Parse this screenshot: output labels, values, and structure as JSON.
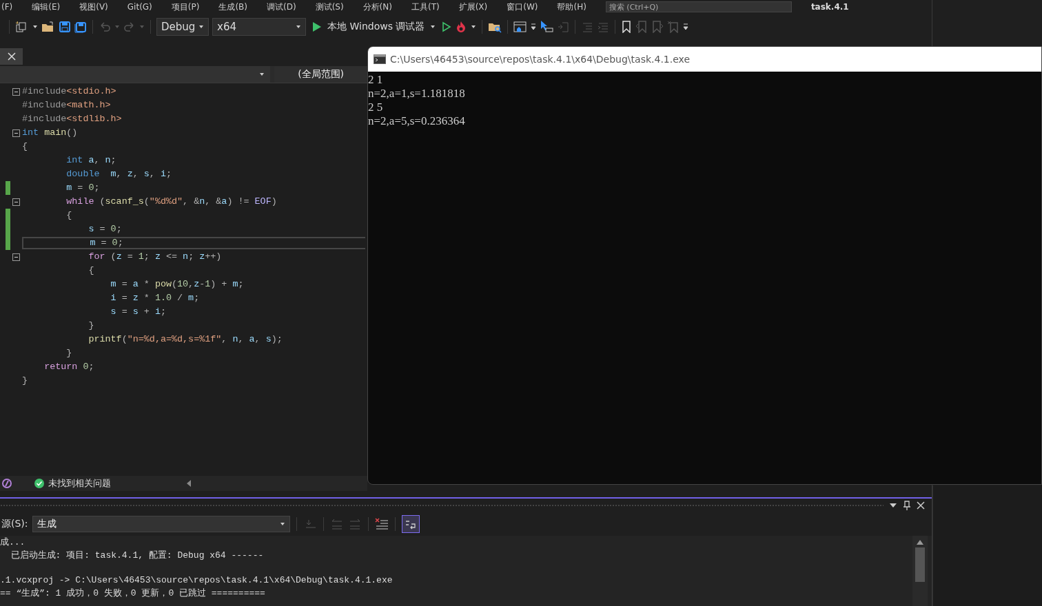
{
  "menu_bar": {
    "items": [
      "(F)",
      "编辑(E)",
      "视图(V)",
      "Git(G)",
      "项目(P)",
      "生成(B)",
      "调试(D)",
      "测试(S)",
      "分析(N)",
      "工具(T)",
      "扩展(X)",
      "窗口(W)",
      "帮助(H)"
    ],
    "search": {
      "placeholder": "搜索 (Ctrl+Q)"
    },
    "solution_title": "task.4.1"
  },
  "toolbar": {
    "configuration": "Debug",
    "platform": "x64",
    "run_button": "本地 Windows 调试器"
  },
  "editor": {
    "scope": "(全局范围)",
    "lines": [
      {
        "foldable": true,
        "changed": false,
        "current": false,
        "tokens": [
          {
            "kind": "dir",
            "text": "#include"
          },
          {
            "kind": "str",
            "text": "<stdio.h>"
          }
        ]
      },
      {
        "foldable": false,
        "changed": false,
        "current": false,
        "tokens": [
          {
            "kind": "dir",
            "text": "#include"
          },
          {
            "kind": "str",
            "text": "<math.h>"
          }
        ]
      },
      {
        "foldable": false,
        "changed": false,
        "current": false,
        "tokens": [
          {
            "kind": "dir",
            "text": "#include"
          },
          {
            "kind": "str",
            "text": "<stdlib.h>"
          }
        ]
      },
      {
        "foldable": true,
        "changed": false,
        "current": false,
        "tokens": [
          {
            "kind": "kw",
            "text": "int"
          },
          {
            "kind": "fn",
            "text": " main"
          },
          {
            "kind": "p",
            "text": "()"
          }
        ]
      },
      {
        "foldable": false,
        "changed": false,
        "current": false,
        "tokens": [
          {
            "kind": "p",
            "text": "{"
          }
        ]
      },
      {
        "foldable": false,
        "changed": false,
        "current": false,
        "tokens": [
          {
            "kind": "kw",
            "text": "        int"
          },
          {
            "kind": "var",
            "text": " a"
          },
          {
            "kind": "p",
            "text": ", "
          },
          {
            "kind": "var",
            "text": "n"
          },
          {
            "kind": "p",
            "text": ";"
          }
        ]
      },
      {
        "foldable": false,
        "changed": false,
        "current": false,
        "tokens": [
          {
            "kind": "kw",
            "text": "        double"
          },
          {
            "kind": "var",
            "text": "  m"
          },
          {
            "kind": "p",
            "text": ", "
          },
          {
            "kind": "var",
            "text": "z"
          },
          {
            "kind": "p",
            "text": ", "
          },
          {
            "kind": "var",
            "text": "s"
          },
          {
            "kind": "p",
            "text": ", "
          },
          {
            "kind": "var",
            "text": "i"
          },
          {
            "kind": "p",
            "text": ";"
          }
        ]
      },
      {
        "foldable": false,
        "changed": true,
        "current": false,
        "tokens": [
          {
            "kind": "var",
            "text": "        m"
          },
          {
            "kind": "p",
            "text": " = "
          },
          {
            "kind": "num",
            "text": "0"
          },
          {
            "kind": "p",
            "text": ";"
          }
        ]
      },
      {
        "foldable": true,
        "changed": false,
        "current": false,
        "tokens": [
          {
            "kind": "ctl",
            "text": "        while"
          },
          {
            "kind": "p",
            "text": " ("
          },
          {
            "kind": "fn",
            "text": "scanf_s"
          },
          {
            "kind": "p",
            "text": "("
          },
          {
            "kind": "str",
            "text": "\"%d%d\""
          },
          {
            "kind": "p",
            "text": ", &"
          },
          {
            "kind": "var",
            "text": "n"
          },
          {
            "kind": "p",
            "text": ", &"
          },
          {
            "kind": "var",
            "text": "a"
          },
          {
            "kind": "p",
            "text": ") != "
          },
          {
            "kind": "mac",
            "text": "EOF"
          },
          {
            "kind": "p",
            "text": ")"
          }
        ]
      },
      {
        "foldable": false,
        "changed": true,
        "current": false,
        "tokens": [
          {
            "kind": "p",
            "text": "        {"
          }
        ]
      },
      {
        "foldable": false,
        "changed": true,
        "current": false,
        "tokens": [
          {
            "kind": "var",
            "text": "            s"
          },
          {
            "kind": "p",
            "text": " = "
          },
          {
            "kind": "num",
            "text": "0"
          },
          {
            "kind": "p",
            "text": ";"
          }
        ]
      },
      {
        "foldable": false,
        "changed": true,
        "current": true,
        "tokens": [
          {
            "kind": "var",
            "text": "            m"
          },
          {
            "kind": "p",
            "text": " = "
          },
          {
            "kind": "num",
            "text": "0"
          },
          {
            "kind": "p",
            "text": ";"
          }
        ]
      },
      {
        "foldable": true,
        "changed": false,
        "current": false,
        "tokens": [
          {
            "kind": "ctl",
            "text": "            for"
          },
          {
            "kind": "p",
            "text": " ("
          },
          {
            "kind": "var",
            "text": "z"
          },
          {
            "kind": "p",
            "text": " = "
          },
          {
            "kind": "num",
            "text": "1"
          },
          {
            "kind": "p",
            "text": "; "
          },
          {
            "kind": "var",
            "text": "z"
          },
          {
            "kind": "p",
            "text": " <= "
          },
          {
            "kind": "var",
            "text": "n"
          },
          {
            "kind": "p",
            "text": "; "
          },
          {
            "kind": "var",
            "text": "z"
          },
          {
            "kind": "p",
            "text": "++)"
          }
        ]
      },
      {
        "foldable": false,
        "changed": false,
        "current": false,
        "tokens": [
          {
            "kind": "p",
            "text": "            {"
          }
        ]
      },
      {
        "foldable": false,
        "changed": false,
        "current": false,
        "tokens": [
          {
            "kind": "var",
            "text": "                m"
          },
          {
            "kind": "p",
            "text": " = "
          },
          {
            "kind": "var",
            "text": "a"
          },
          {
            "kind": "p",
            "text": " * "
          },
          {
            "kind": "fn",
            "text": "pow"
          },
          {
            "kind": "p",
            "text": "("
          },
          {
            "kind": "num",
            "text": "10"
          },
          {
            "kind": "p",
            "text": ","
          },
          {
            "kind": "var",
            "text": "z"
          },
          {
            "kind": "p",
            "text": "-"
          },
          {
            "kind": "num",
            "text": "1"
          },
          {
            "kind": "p",
            "text": ") + "
          },
          {
            "kind": "var",
            "text": "m"
          },
          {
            "kind": "p",
            "text": ";"
          }
        ]
      },
      {
        "foldable": false,
        "changed": false,
        "current": false,
        "tokens": [
          {
            "kind": "var",
            "text": "                i"
          },
          {
            "kind": "p",
            "text": " = "
          },
          {
            "kind": "var",
            "text": "z"
          },
          {
            "kind": "p",
            "text": " * "
          },
          {
            "kind": "num",
            "text": "1.0"
          },
          {
            "kind": "p",
            "text": " / "
          },
          {
            "kind": "var",
            "text": "m"
          },
          {
            "kind": "p",
            "text": ";"
          }
        ]
      },
      {
        "foldable": false,
        "changed": false,
        "current": false,
        "tokens": [
          {
            "kind": "var",
            "text": "                s"
          },
          {
            "kind": "p",
            "text": " = "
          },
          {
            "kind": "var",
            "text": "s"
          },
          {
            "kind": "p",
            "text": " + "
          },
          {
            "kind": "var",
            "text": "i"
          },
          {
            "kind": "p",
            "text": ";"
          }
        ]
      },
      {
        "foldable": false,
        "changed": false,
        "current": false,
        "tokens": [
          {
            "kind": "p",
            "text": "            }"
          }
        ]
      },
      {
        "foldable": false,
        "changed": false,
        "current": false,
        "tokens": [
          {
            "kind": "fn",
            "text": "            printf"
          },
          {
            "kind": "p",
            "text": "("
          },
          {
            "kind": "str",
            "text": "\"n=%d,a=%d,s=%1f\""
          },
          {
            "kind": "p",
            "text": ", "
          },
          {
            "kind": "var",
            "text": "n"
          },
          {
            "kind": "p",
            "text": ", "
          },
          {
            "kind": "var",
            "text": "a"
          },
          {
            "kind": "p",
            "text": ", "
          },
          {
            "kind": "var",
            "text": "s"
          },
          {
            "kind": "p",
            "text": ");"
          }
        ]
      },
      {
        "foldable": false,
        "changed": false,
        "current": false,
        "tokens": [
          {
            "kind": "p",
            "text": "        }"
          }
        ]
      },
      {
        "foldable": false,
        "changed": false,
        "current": false,
        "tokens": [
          {
            "kind": "ctl",
            "text": "    return"
          },
          {
            "kind": "num",
            "text": " 0"
          },
          {
            "kind": "p",
            "text": ";"
          }
        ]
      },
      {
        "foldable": false,
        "changed": false,
        "current": false,
        "tokens": [
          {
            "kind": "p",
            "text": "}"
          }
        ]
      }
    ],
    "status": "未找到相关问题"
  },
  "output": {
    "source_label": "源(S):",
    "source": "生成",
    "word_wrap": true,
    "lines": [
      "成...",
      "  已启动生成: 项目: task.4.1, 配置: Debug x64 ------",
      ".1.vcxproj -> C:\\Users\\46453\\source\\repos\\task.4.1\\x64\\Debug\\task.4.1.exe",
      "== “生成”: 1 成功，0 失败，0 更新，0 已跳过 =========="
    ]
  },
  "console": {
    "title": "C:\\Users\\46453\\source\\repos\\task.4.1\\x64\\Debug\\task.4.1.exe",
    "lines": [
      "2 1",
      "n=2,a=1,s=1.181818",
      "2 5",
      "n=2,a=5,s=0.236364"
    ]
  }
}
